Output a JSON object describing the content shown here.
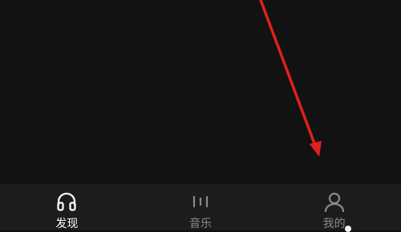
{
  "colors": {
    "background": "#121212",
    "tab_bar": "#1c1c1c",
    "active_text": "#ffffff",
    "inactive_text": "#8a8a8a",
    "annotation_arrow": "#e0201b"
  },
  "tab_bar": {
    "tabs": [
      {
        "label": "发现",
        "icon": "headphones-icon",
        "active": true
      },
      {
        "label": "音乐",
        "icon": "bars-icon",
        "active": false
      },
      {
        "label": "我的",
        "icon": "user-icon",
        "active": false
      }
    ]
  },
  "annotation": {
    "type": "arrow",
    "points_to": "tab-mine"
  }
}
